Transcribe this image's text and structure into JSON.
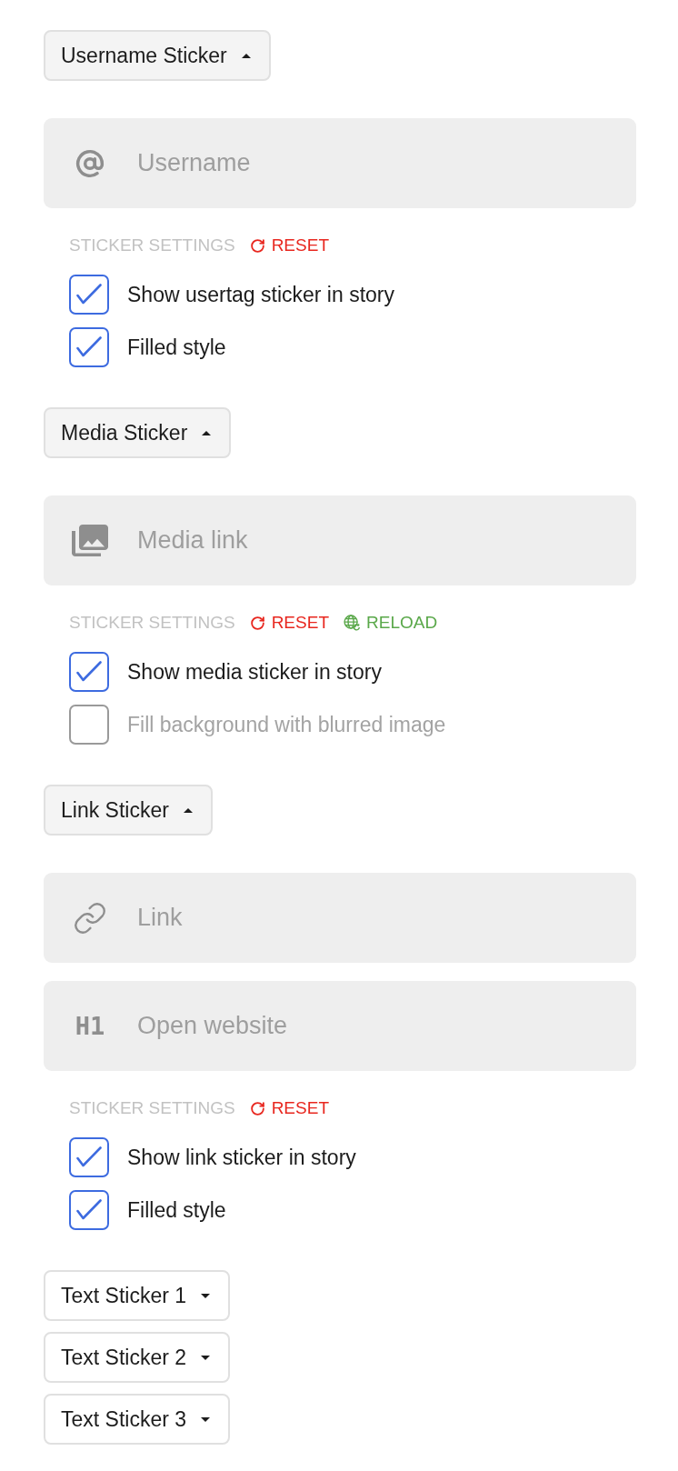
{
  "sections": [
    {
      "title": "Username Sticker",
      "expanded": true,
      "fields": [
        {
          "kind": "mention",
          "placeholder": "Username"
        }
      ],
      "settings": {
        "label": "STICKER SETTINGS",
        "actions": [
          {
            "kind": "reset",
            "label": "RESET"
          }
        ]
      },
      "options": [
        {
          "label": "Show usertag sticker in story",
          "checked": true
        },
        {
          "label": "Filled style",
          "checked": true
        }
      ]
    },
    {
      "title": "Media Sticker",
      "expanded": true,
      "fields": [
        {
          "kind": "media",
          "placeholder": "Media link"
        }
      ],
      "settings": {
        "label": "STICKER SETTINGS",
        "actions": [
          {
            "kind": "reset",
            "label": "RESET"
          },
          {
            "kind": "reload",
            "label": "RELOAD"
          }
        ]
      },
      "options": [
        {
          "label": "Show media sticker in story",
          "checked": true
        },
        {
          "label": "Fill background with blurred image",
          "checked": false
        }
      ]
    },
    {
      "title": "Link Sticker",
      "expanded": true,
      "fields": [
        {
          "kind": "link",
          "placeholder": "Link"
        },
        {
          "kind": "heading",
          "prefix": "H1",
          "placeholder": "Open website"
        }
      ],
      "settings": {
        "label": "STICKER SETTINGS",
        "actions": [
          {
            "kind": "reset",
            "label": "RESET"
          }
        ]
      },
      "options": [
        {
          "label": "Show link sticker in story",
          "checked": true
        },
        {
          "label": "Filled style",
          "checked": true
        }
      ]
    },
    {
      "title": "Text Sticker 1",
      "expanded": false
    },
    {
      "title": "Text Sticker 2",
      "expanded": false
    },
    {
      "title": "Text Sticker 3",
      "expanded": false
    }
  ]
}
